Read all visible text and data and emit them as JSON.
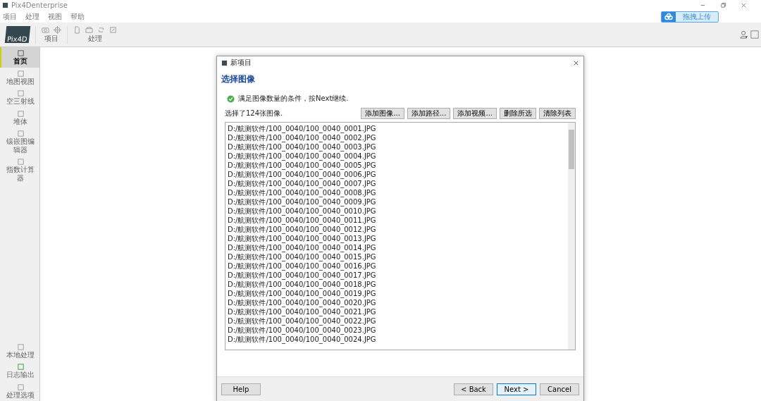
{
  "window": {
    "title": "Pix4Denterprise"
  },
  "menu": [
    "项目",
    "处理",
    "视图",
    "帮助"
  ],
  "toolbar": {
    "logo": "Pix4D",
    "groups": [
      {
        "label": "项目"
      },
      {
        "label": "处理"
      }
    ]
  },
  "upload_button": "拖拽上传",
  "sidebar": {
    "items": [
      {
        "label": "首页",
        "selected": true
      },
      {
        "label": "地图视图",
        "selected": false
      },
      {
        "label": "空三射线",
        "selected": false
      },
      {
        "label": "堆体",
        "selected": false
      },
      {
        "label": "镶嵌图编辑器",
        "selected": false
      },
      {
        "label": "指数计算器",
        "selected": false
      }
    ],
    "bottom_items": [
      {
        "label": "本地处理"
      },
      {
        "label": "日志输出"
      },
      {
        "label": "处理选项"
      }
    ]
  },
  "dialog": {
    "title": "新项目",
    "heading": "选择图像",
    "status": "满足图像数量的条件，按Next继续.",
    "count": "选择了124张图像.",
    "actions": [
      "添加图像...",
      "添加路径...",
      "添加视频...",
      "删除所选",
      "清除列表"
    ],
    "files": [
      "D:/航测软件/100_0040/100_0040_0001.JPG",
      "D:/航测软件/100_0040/100_0040_0002.JPG",
      "D:/航测软件/100_0040/100_0040_0003.JPG",
      "D:/航测软件/100_0040/100_0040_0004.JPG",
      "D:/航测软件/100_0040/100_0040_0005.JPG",
      "D:/航测软件/100_0040/100_0040_0006.JPG",
      "D:/航测软件/100_0040/100_0040_0007.JPG",
      "D:/航测软件/100_0040/100_0040_0008.JPG",
      "D:/航测软件/100_0040/100_0040_0009.JPG",
      "D:/航测软件/100_0040/100_0040_0010.JPG",
      "D:/航测软件/100_0040/100_0040_0011.JPG",
      "D:/航测软件/100_0040/100_0040_0012.JPG",
      "D:/航测软件/100_0040/100_0040_0013.JPG",
      "D:/航测软件/100_0040/100_0040_0014.JPG",
      "D:/航测软件/100_0040/100_0040_0015.JPG",
      "D:/航测软件/100_0040/100_0040_0016.JPG",
      "D:/航测软件/100_0040/100_0040_0017.JPG",
      "D:/航测软件/100_0040/100_0040_0018.JPG",
      "D:/航测软件/100_0040/100_0040_0019.JPG",
      "D:/航测软件/100_0040/100_0040_0020.JPG",
      "D:/航测软件/100_0040/100_0040_0021.JPG",
      "D:/航测软件/100_0040/100_0040_0022.JPG",
      "D:/航测软件/100_0040/100_0040_0023.JPG",
      "D:/航测软件/100_0040/100_0040_0024.JPG"
    ],
    "footer_buttons": [
      {
        "label": "Help",
        "focused": false
      },
      {
        "label": "< Back",
        "focused": false
      },
      {
        "label": "Next >",
        "focused": true
      },
      {
        "label": "Cancel",
        "focused": false
      }
    ]
  }
}
